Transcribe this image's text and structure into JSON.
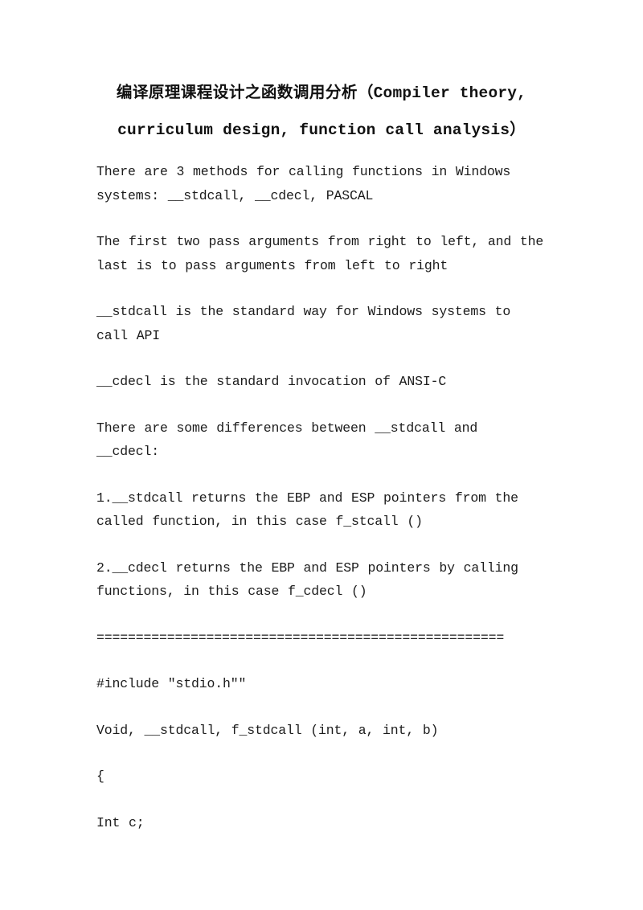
{
  "document": {
    "title": {
      "cjk": "编译原理课程设计之函数调用分析",
      "latin": "（Compiler theory, curriculum design, function call analysis）"
    },
    "paragraphs": [
      "There are 3 methods for calling functions in Windows systems: __stdcall, __cdecl, PASCAL",
      "The first two pass arguments from right to left, and the last is to pass arguments from left to right",
      "__stdcall is the standard way for Windows systems to call API",
      "__cdecl is the standard invocation of ANSI-C",
      "There are some differences between __stdcall and __cdecl:",
      "1.__stdcall returns the EBP and ESP pointers from the called function, in this case f_stcall ()",
      "2.__cdecl returns the EBP and ESP pointers by calling functions, in this case f_cdecl ()"
    ],
    "separator": "====================================================",
    "code_lines": [
      "#include \"stdio.h\"\"",
      "Void, __stdcall, f_stdcall (int, a, int, b)",
      "{",
      "Int c;"
    ]
  }
}
